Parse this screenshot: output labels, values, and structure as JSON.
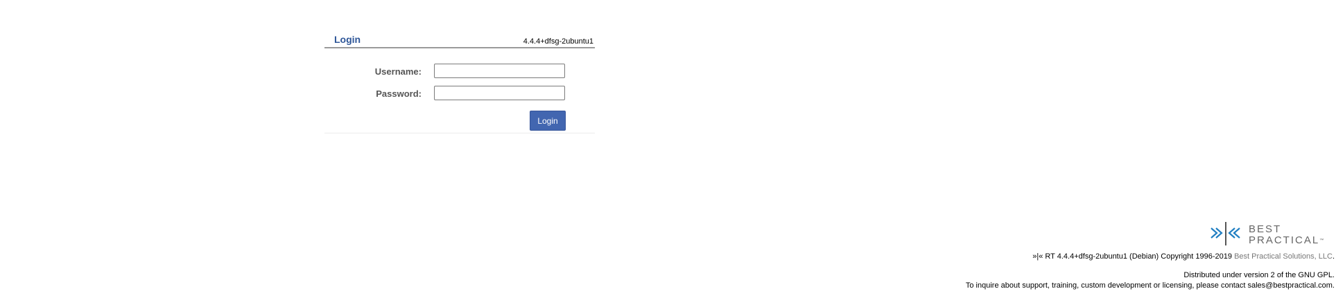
{
  "login": {
    "title": "Login",
    "version": "4.4.4+dfsg-2ubuntu1",
    "username_label": "Username:",
    "password_label": "Password:",
    "username_value": "",
    "password_value": "",
    "submit_label": "Login"
  },
  "footer": {
    "logo": {
      "line1": "BEST",
      "line2": "PRACTICAL",
      "tm": "™"
    },
    "copyright_prefix": "»|« RT 4.4.4+dfsg-2ubuntu1 (Debian) Copyright 1996-2019 ",
    "company": "Best Practical Solutions, LLC",
    "copyright_suffix": ".",
    "gpl": "Distributed under version 2 of the GNU GPL.",
    "contact": "To inquire about support, training, custom development or licensing, please contact sales@bestpractical.com."
  },
  "colors": {
    "title": "#2e5698",
    "button": "#4266b0",
    "logo_mark": "#1f7ec2",
    "logo_text": "#666666"
  }
}
